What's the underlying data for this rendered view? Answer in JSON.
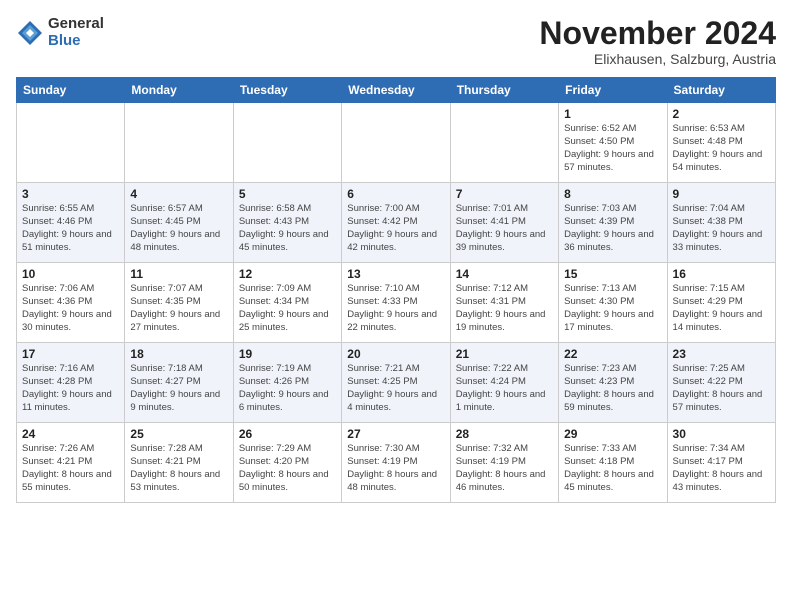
{
  "logo": {
    "general": "General",
    "blue": "Blue"
  },
  "title": "November 2024",
  "location": "Elixhausen, Salzburg, Austria",
  "headers": [
    "Sunday",
    "Monday",
    "Tuesday",
    "Wednesday",
    "Thursday",
    "Friday",
    "Saturday"
  ],
  "weeks": [
    [
      {
        "day": "",
        "info": ""
      },
      {
        "day": "",
        "info": ""
      },
      {
        "day": "",
        "info": ""
      },
      {
        "day": "",
        "info": ""
      },
      {
        "day": "",
        "info": ""
      },
      {
        "day": "1",
        "info": "Sunrise: 6:52 AM\nSunset: 4:50 PM\nDaylight: 9 hours and 57 minutes."
      },
      {
        "day": "2",
        "info": "Sunrise: 6:53 AM\nSunset: 4:48 PM\nDaylight: 9 hours and 54 minutes."
      }
    ],
    [
      {
        "day": "3",
        "info": "Sunrise: 6:55 AM\nSunset: 4:46 PM\nDaylight: 9 hours and 51 minutes."
      },
      {
        "day": "4",
        "info": "Sunrise: 6:57 AM\nSunset: 4:45 PM\nDaylight: 9 hours and 48 minutes."
      },
      {
        "day": "5",
        "info": "Sunrise: 6:58 AM\nSunset: 4:43 PM\nDaylight: 9 hours and 45 minutes."
      },
      {
        "day": "6",
        "info": "Sunrise: 7:00 AM\nSunset: 4:42 PM\nDaylight: 9 hours and 42 minutes."
      },
      {
        "day": "7",
        "info": "Sunrise: 7:01 AM\nSunset: 4:41 PM\nDaylight: 9 hours and 39 minutes."
      },
      {
        "day": "8",
        "info": "Sunrise: 7:03 AM\nSunset: 4:39 PM\nDaylight: 9 hours and 36 minutes."
      },
      {
        "day": "9",
        "info": "Sunrise: 7:04 AM\nSunset: 4:38 PM\nDaylight: 9 hours and 33 minutes."
      }
    ],
    [
      {
        "day": "10",
        "info": "Sunrise: 7:06 AM\nSunset: 4:36 PM\nDaylight: 9 hours and 30 minutes."
      },
      {
        "day": "11",
        "info": "Sunrise: 7:07 AM\nSunset: 4:35 PM\nDaylight: 9 hours and 27 minutes."
      },
      {
        "day": "12",
        "info": "Sunrise: 7:09 AM\nSunset: 4:34 PM\nDaylight: 9 hours and 25 minutes."
      },
      {
        "day": "13",
        "info": "Sunrise: 7:10 AM\nSunset: 4:33 PM\nDaylight: 9 hours and 22 minutes."
      },
      {
        "day": "14",
        "info": "Sunrise: 7:12 AM\nSunset: 4:31 PM\nDaylight: 9 hours and 19 minutes."
      },
      {
        "day": "15",
        "info": "Sunrise: 7:13 AM\nSunset: 4:30 PM\nDaylight: 9 hours and 17 minutes."
      },
      {
        "day": "16",
        "info": "Sunrise: 7:15 AM\nSunset: 4:29 PM\nDaylight: 9 hours and 14 minutes."
      }
    ],
    [
      {
        "day": "17",
        "info": "Sunrise: 7:16 AM\nSunset: 4:28 PM\nDaylight: 9 hours and 11 minutes."
      },
      {
        "day": "18",
        "info": "Sunrise: 7:18 AM\nSunset: 4:27 PM\nDaylight: 9 hours and 9 minutes."
      },
      {
        "day": "19",
        "info": "Sunrise: 7:19 AM\nSunset: 4:26 PM\nDaylight: 9 hours and 6 minutes."
      },
      {
        "day": "20",
        "info": "Sunrise: 7:21 AM\nSunset: 4:25 PM\nDaylight: 9 hours and 4 minutes."
      },
      {
        "day": "21",
        "info": "Sunrise: 7:22 AM\nSunset: 4:24 PM\nDaylight: 9 hours and 1 minute."
      },
      {
        "day": "22",
        "info": "Sunrise: 7:23 AM\nSunset: 4:23 PM\nDaylight: 8 hours and 59 minutes."
      },
      {
        "day": "23",
        "info": "Sunrise: 7:25 AM\nSunset: 4:22 PM\nDaylight: 8 hours and 57 minutes."
      }
    ],
    [
      {
        "day": "24",
        "info": "Sunrise: 7:26 AM\nSunset: 4:21 PM\nDaylight: 8 hours and 55 minutes."
      },
      {
        "day": "25",
        "info": "Sunrise: 7:28 AM\nSunset: 4:21 PM\nDaylight: 8 hours and 53 minutes."
      },
      {
        "day": "26",
        "info": "Sunrise: 7:29 AM\nSunset: 4:20 PM\nDaylight: 8 hours and 50 minutes."
      },
      {
        "day": "27",
        "info": "Sunrise: 7:30 AM\nSunset: 4:19 PM\nDaylight: 8 hours and 48 minutes."
      },
      {
        "day": "28",
        "info": "Sunrise: 7:32 AM\nSunset: 4:19 PM\nDaylight: 8 hours and 46 minutes."
      },
      {
        "day": "29",
        "info": "Sunrise: 7:33 AM\nSunset: 4:18 PM\nDaylight: 8 hours and 45 minutes."
      },
      {
        "day": "30",
        "info": "Sunrise: 7:34 AM\nSunset: 4:17 PM\nDaylight: 8 hours and 43 minutes."
      }
    ]
  ]
}
